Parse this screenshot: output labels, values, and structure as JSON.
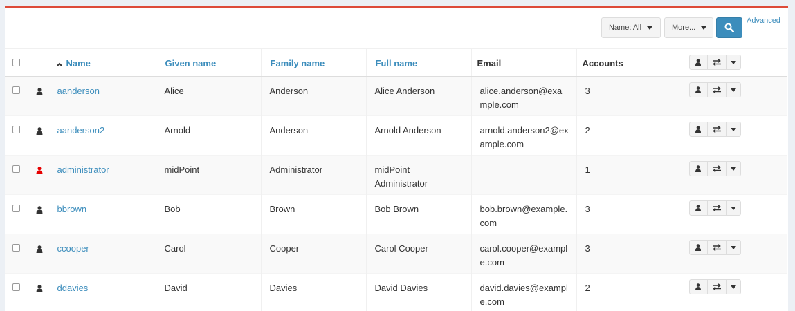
{
  "toolbar": {
    "name_filter_label": "Name: All",
    "more_label": "More...",
    "advanced_label": "Advanced"
  },
  "columns": {
    "name": "Name",
    "given_name": "Given name",
    "family_name": "Family name",
    "full_name": "Full name",
    "email": "Email",
    "accounts": "Accounts"
  },
  "colors": {
    "accent": "#3c8dbc",
    "top_border": "#dd4b39",
    "user_icon": "#333333",
    "admin_icon": "#e60000"
  },
  "rows": [
    {
      "name": "aanderson",
      "given_name": "Alice",
      "family_name": "Anderson",
      "full_name": "Alice Anderson",
      "email": "alice.anderson@example.com",
      "accounts": "3",
      "icon": "user-icon"
    },
    {
      "name": "aanderson2",
      "given_name": "Arnold",
      "family_name": "Anderson",
      "full_name": "Arnold Anderson",
      "email": "arnold.anderson2@example.com",
      "accounts": "2",
      "icon": "user-icon"
    },
    {
      "name": "administrator",
      "given_name": "midPoint",
      "family_name": "Administrator",
      "full_name": "midPoint Administrator",
      "email": "",
      "accounts": "1",
      "icon": "admin-user-icon"
    },
    {
      "name": "bbrown",
      "given_name": "Bob",
      "family_name": "Brown",
      "full_name": "Bob Brown",
      "email": "bob.brown@example.com",
      "accounts": "3",
      "icon": "user-icon"
    },
    {
      "name": "ccooper",
      "given_name": "Carol",
      "family_name": "Cooper",
      "full_name": "Carol Cooper",
      "email": "carol.cooper@example.com",
      "accounts": "3",
      "icon": "user-icon"
    },
    {
      "name": "ddavies",
      "given_name": "David",
      "family_name": "Davies",
      "full_name": "David Davies",
      "email": "david.davies@example.com",
      "accounts": "2",
      "icon": "user-icon"
    }
  ]
}
